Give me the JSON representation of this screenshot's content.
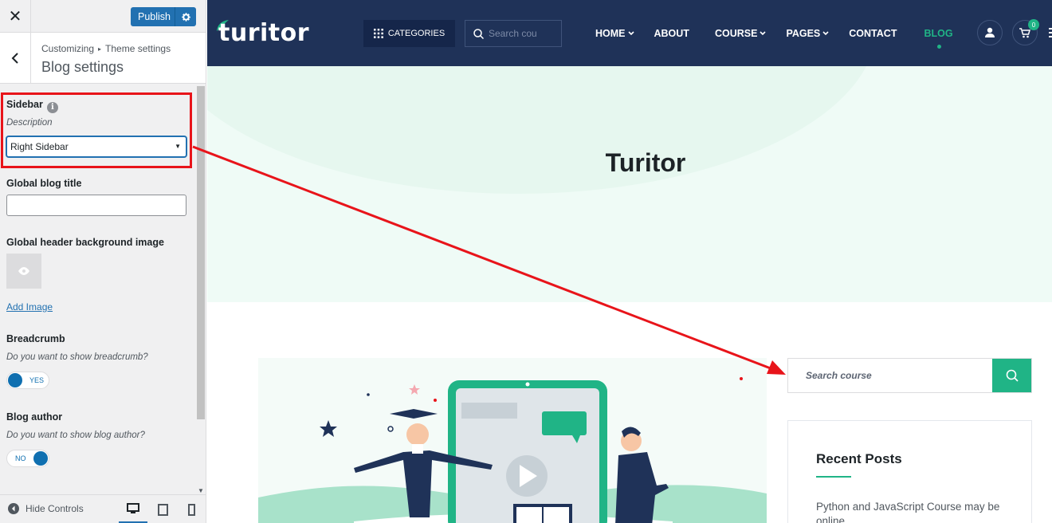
{
  "customizer": {
    "close_glyph": "✕",
    "publish_label": "Publish",
    "breadcrumb": {
      "root": "Customizing",
      "separator": "▸",
      "parent": "Theme settings"
    },
    "section_title": "Blog settings",
    "controls": {
      "sidebar": {
        "label": "Sidebar",
        "info": "i",
        "description": "Description",
        "selected": "Right Sidebar",
        "caret": "▼"
      },
      "global_blog_title": {
        "label": "Global blog title",
        "value": ""
      },
      "header_bg": {
        "label": "Global header background image",
        "add_link": "Add Image"
      },
      "breadcrumb": {
        "label": "Breadcrumb",
        "description": "Do you want to show breadcrumb?",
        "toggle_text": "YES",
        "checked": true
      },
      "blog_author": {
        "label": "Blog author",
        "description": "Do you want to show blog author?",
        "toggle_text": "NO",
        "checked": false
      }
    },
    "footer": {
      "hide_controls": "Hide Controls",
      "devices": [
        "desktop",
        "tablet",
        "mobile"
      ],
      "active_device": "desktop"
    },
    "colors": {
      "accent": "#2271b1",
      "highlight": "#e8141a"
    }
  },
  "preview": {
    "logo_text": "turitor",
    "categories_label": "CATEGORIES",
    "search_placeholder": "Search cou",
    "menu": [
      {
        "label": "HOME",
        "dropdown": true
      },
      {
        "label": "ABOUT",
        "dropdown": false
      },
      {
        "label": "COURSE",
        "dropdown": true
      },
      {
        "label": "PAGES",
        "dropdown": true
      },
      {
        "label": "CONTACT",
        "dropdown": false
      },
      {
        "label": "BLOG",
        "dropdown": false,
        "active": true
      }
    ],
    "cart_count": "0",
    "hero_title": "Turitor",
    "sidebar_search_placeholder": "Search course",
    "recent_posts_title": "Recent Posts",
    "recent_post_1": "Python and JavaScript Course may be online",
    "colors": {
      "navbar": "#1f3258",
      "brand_green": "#20b486",
      "hero_bg": "#effbf6"
    }
  }
}
